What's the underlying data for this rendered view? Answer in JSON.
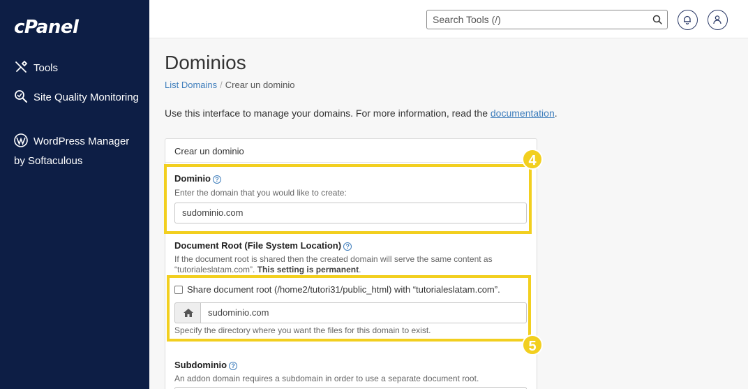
{
  "app": {
    "logo": "cPanel"
  },
  "sidebar": {
    "items": [
      {
        "label": "Tools",
        "icon": "tools-icon"
      },
      {
        "label": "Site Quality Monitoring",
        "icon": "site-quality-icon"
      },
      {
        "label": "WordPress Manager by Softaculous",
        "icon": "wordpress-icon"
      }
    ]
  },
  "header": {
    "search_placeholder": "Search Tools (/)",
    "notifications_icon": "bell-icon",
    "user_icon": "user-icon"
  },
  "page": {
    "title": "Dominios",
    "breadcrumb": {
      "link": "List Domains",
      "separator": "/",
      "current": "Crear un dominio"
    },
    "intro_text": "Use this interface to manage your domains. For more information, read the ",
    "intro_link": "documentation",
    "intro_end": "."
  },
  "form": {
    "panel_title": "Crear un dominio",
    "domain": {
      "label": "Dominio",
      "hint": "Enter the domain that you would like to create:",
      "value": "sudominio.com"
    },
    "docroot": {
      "label": "Document Root (File System Location)",
      "hint_line1": "If the document root is shared then the created domain will serve the same content as",
      "hint_line2": "“tutorialeslatam.com”. ",
      "hint_bold": "This setting is permanent",
      "hint_end": ".",
      "share_label": "Share document root (/home2/tutori31/public_html) with “tutorialeslatam.com”.",
      "share_checked": false,
      "path_value": "sudominio.com",
      "path_hint": "Specify the directory where you want the files for this domain to exist."
    },
    "subdomain": {
      "label": "Subdominio",
      "hint": "An addon domain requires a subdomain in order to use a separate document root."
    }
  },
  "annotations": {
    "badge_4": "4",
    "badge_5": "5",
    "highlight_color": "#f2cf1f"
  },
  "colors": {
    "sidebar_bg": "#0d1e45",
    "link": "#3f7ebc"
  }
}
